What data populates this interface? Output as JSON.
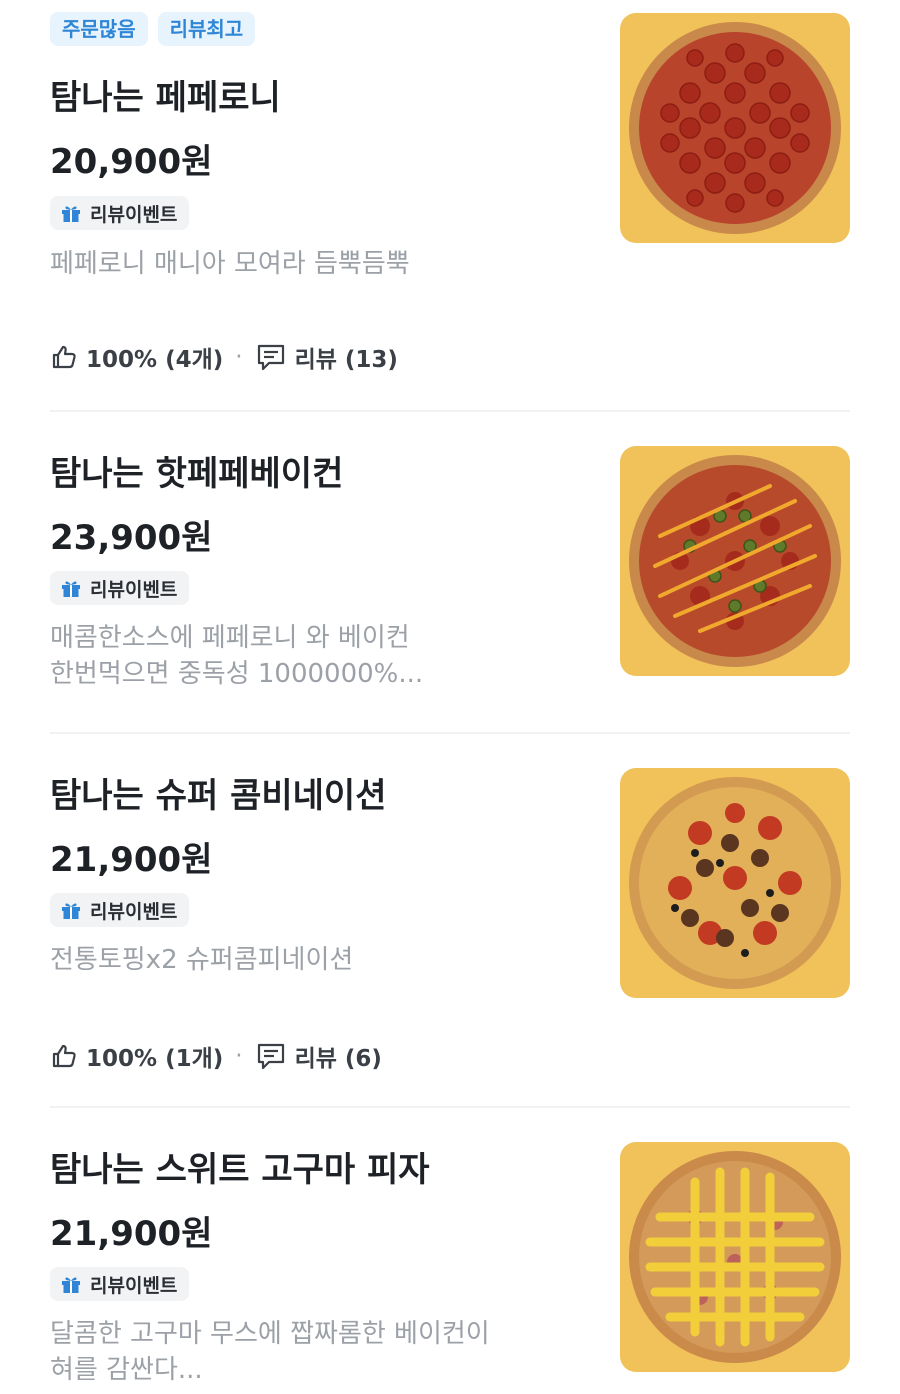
{
  "items": [
    {
      "badges": [
        "주문많음",
        "리뷰최고"
      ],
      "title": "탐나는 페페로니",
      "price": "20,900원",
      "event_label": "리뷰이벤트",
      "description_lines": [
        "페페로니 매니아 모여라 듬뿍듬뿍"
      ],
      "rating": "100% (4개)",
      "review_label": "리뷰 (13)",
      "pizza_style": "pepperoni"
    },
    {
      "title": "탐나는 핫페페베이컨",
      "price": "23,900원",
      "event_label": "리뷰이벤트",
      "description_lines": [
        "매콤한소스에 페페로니 와 베이컨",
        "한번먹으면 중독성 1000000%..."
      ],
      "pizza_style": "hot-pepperoni-bacon"
    },
    {
      "title": "탐나는 슈퍼 콤비네이션",
      "price": "21,900원",
      "event_label": "리뷰이벤트",
      "description_lines": [
        "전통토핑x2 슈퍼콤피네이션"
      ],
      "rating": "100% (1개)",
      "review_label": "리뷰 (6)",
      "pizza_style": "combination"
    },
    {
      "title": "탐나는 스위트 고구마 피자",
      "price": "21,900원",
      "event_label": "리뷰이벤트",
      "description_lines": [
        "달콤한 고구마 무스에 짭짜롬한 베이컨이",
        "혀를 감싼다..."
      ],
      "pizza_style": "sweet-potato"
    }
  ],
  "colors": {
    "badge_bg": "#e7f3fd",
    "badge_text": "#2f86d6",
    "gift_icon": "#2f86d6",
    "thumb_bg": "#f1c15a"
  },
  "icons": {
    "gift": "gift-icon",
    "thumbs_up": "thumbs-up-icon",
    "review": "review-bubble-icon"
  }
}
